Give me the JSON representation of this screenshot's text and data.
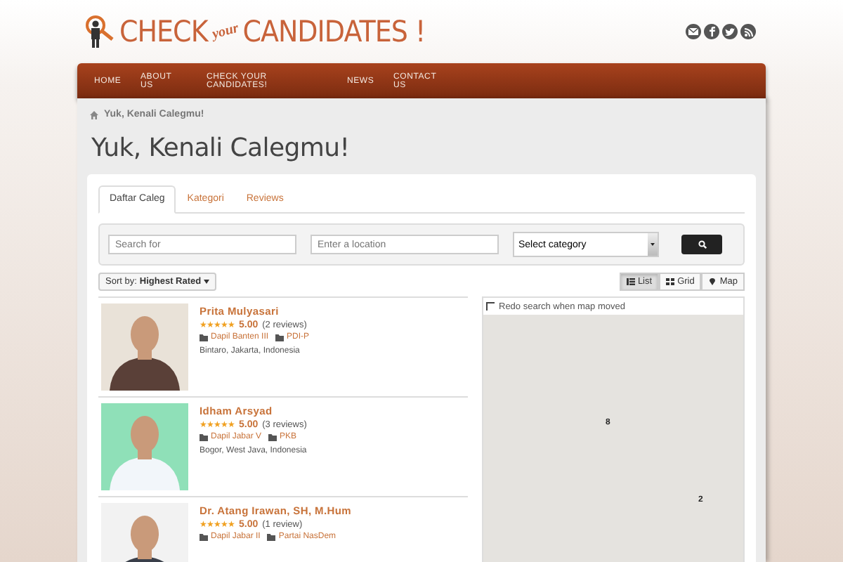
{
  "logo": {
    "word_1": "CHECK",
    "word_2": "your",
    "word_3": "CANDIDATES !"
  },
  "nav": [
    {
      "label": "HOME"
    },
    {
      "label": "ABOUT US"
    },
    {
      "label": "CHECK YOUR CANDIDATES!"
    },
    {
      "label": "NEWS"
    },
    {
      "label": "CONTACT US"
    }
  ],
  "breadcrumb": "Yuk, Kenali Calegmu!",
  "page_title": "Yuk, Kenali Calegmu!",
  "tabs": [
    {
      "label": "Daftar Caleg",
      "selected": true
    },
    {
      "label": "Kategori",
      "selected": false
    },
    {
      "label": "Reviews",
      "selected": false
    }
  ],
  "search": {
    "keyword": {
      "placeholder": "Search for"
    },
    "location": {
      "placeholder": "Enter a location"
    },
    "category": "Select category"
  },
  "sort": {
    "label": "Sort by:",
    "value": "Highest Rated"
  },
  "views": [
    {
      "label": "List",
      "selected": true
    },
    {
      "label": "Grid",
      "selected": false
    },
    {
      "label": "Map",
      "selected": false
    }
  ],
  "candidates": [
    {
      "name": "Prita Mulyasari",
      "stars": 5,
      "rating": "5.00",
      "reviews": "(2 reviews)",
      "tags": [
        "Dapil Banten III",
        "PDI-P"
      ],
      "location": "Bintaro, Jakarta, Indonesia",
      "photo": {
        "kind": "picture"
      }
    },
    {
      "name": "Idham Arsyad",
      "stars": 5,
      "rating": "5.00",
      "reviews": "(3 reviews)",
      "tags": [
        "Dapil Jabar V",
        "PKB"
      ],
      "location": "Bogor, West Java, Indonesia",
      "photo": {
        "kind": "picture"
      }
    },
    {
      "name": "Dr. Atang Irawan, SH, M.Hum",
      "stars": 5,
      "rating": "5.00",
      "reviews": "(1 review)",
      "tags": [
        "Dapil Jabar II",
        "Partai NasDem"
      ],
      "photo": {
        "kind": "picture"
      }
    }
  ],
  "map": {
    "redo_label": "Redo search when map moved",
    "redo_checked": false,
    "clusters": [
      "8",
      "2"
    ]
  }
}
